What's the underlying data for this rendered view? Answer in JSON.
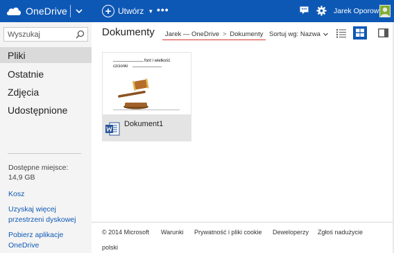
{
  "header": {
    "brand": "OneDrive",
    "create_label": "Utwórz",
    "more_label": "•••",
    "user_name": "Jarek Oporowy",
    "colors": {
      "bar": "#0e58b5",
      "accent_red": "#d9322b"
    }
  },
  "sidebar": {
    "search_placeholder": "Wyszukaj",
    "items": [
      {
        "label": "Pliki",
        "active": true
      },
      {
        "label": "Ostatnie",
        "active": false
      },
      {
        "label": "Zdjęcia",
        "active": false
      },
      {
        "label": "Udostępnione",
        "active": false
      }
    ],
    "storage_label": "Dostępne miejsce:",
    "storage_value": "14,9 GB",
    "links": [
      "Kosz",
      "Uzyskaj więcej przestrzeni dyskowej",
      "Pobierz aplikacje OneDrive"
    ]
  },
  "main": {
    "title": "Dokumenty",
    "breadcrumb": [
      "Jarek — OneDrive",
      "Dokumenty"
    ],
    "breadcrumb_sep": ">",
    "sort_label": "Sortuj wg: Nazwa",
    "files": [
      {
        "name": "Dokument1",
        "type": "word-document",
        "thumb_text_a": "font i wielkość",
        "thumb_text_b": "czcionki"
      }
    ]
  },
  "footer": {
    "links": [
      "© 2014 Microsoft",
      "Warunki",
      "Prywatność i pliki cookie",
      "Deweloperzy",
      "Zgłoś nadużycie"
    ],
    "language": "polski"
  }
}
